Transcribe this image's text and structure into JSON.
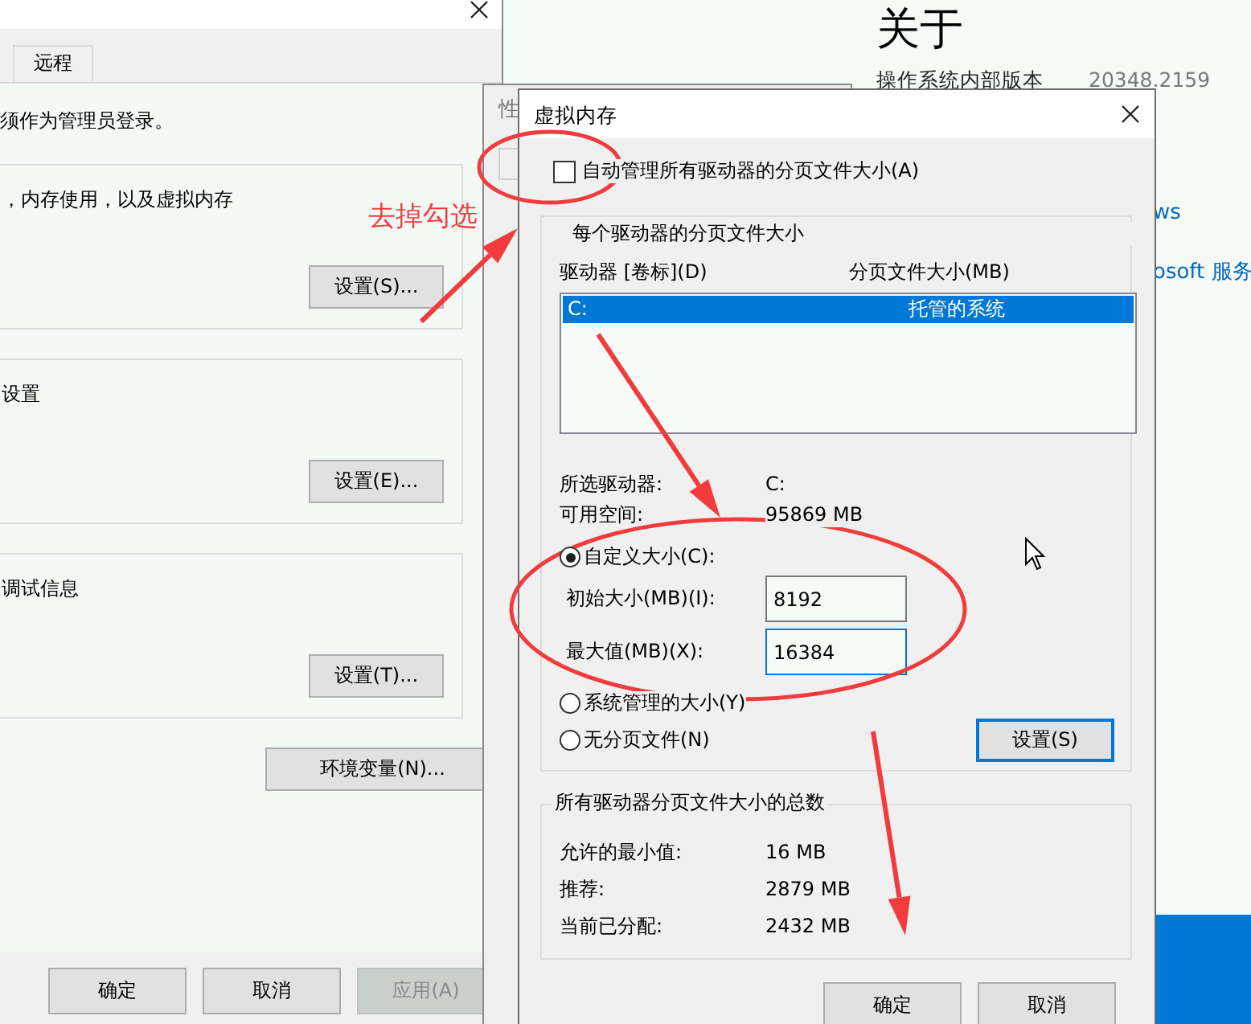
{
  "settings_page": {
    "title": "关于",
    "spec_label": "操作系统内部版本",
    "spec_value": "20348.2159",
    "links": [
      "ws",
      "osoft 服务"
    ]
  },
  "system_properties": {
    "tabs": [
      {
        "label": "远程",
        "selected": false
      }
    ],
    "admin_note": "须作为管理员登录。",
    "groups": [
      {
        "text": "，内存使用，以及虚拟内存",
        "button": "设置(S)..."
      },
      {
        "text": "设置",
        "button": "设置(E)..."
      },
      {
        "text": "调试信息",
        "button": "设置(T)..."
      }
    ],
    "env_button": "环境变量(N)...",
    "buttons": [
      {
        "label": "确定",
        "disabled": false
      },
      {
        "label": "取消",
        "disabled": false
      },
      {
        "label": "应用(A)",
        "disabled": true
      }
    ]
  },
  "performance_options": {
    "title": "性"
  },
  "virtual_memory": {
    "title": "虚拟内存",
    "auto_manage": {
      "label": "自动管理所有驱动器的分页文件大小(A)",
      "checked": false
    },
    "drives_group": {
      "title": "每个驱动器的分页文件大小",
      "columns": [
        "驱动器 [卷标](D)",
        "分页文件大小(MB)"
      ],
      "rows": [
        {
          "drive": "C:",
          "size": "托管的系统",
          "selected": true
        }
      ],
      "info": [
        {
          "label": "所选驱动器:",
          "value": "C:"
        },
        {
          "label": "可用空间:",
          "value": "95869 MB"
        }
      ],
      "options": [
        {
          "label": "自定义大小(C):",
          "selected": true
        },
        {
          "label": "系统管理的大小(Y)",
          "selected": false
        },
        {
          "label": "无分页文件(N)",
          "selected": false
        }
      ],
      "fields": [
        {
          "label": "初始大小(MB)(I):",
          "value": "8192",
          "focused": false
        },
        {
          "label": "最大值(MB)(X):",
          "value": "16384",
          "focused": true
        }
      ],
      "set_button": "设置(S)"
    },
    "totals": {
      "title": "所有驱动器分页文件大小的总数",
      "rows": [
        {
          "label": "允许的最小值:",
          "value": "16 MB"
        },
        {
          "label": "推荐:",
          "value": "2879 MB"
        },
        {
          "label": "当前已分配:",
          "value": "2432 MB"
        }
      ]
    },
    "buttons": [
      "确定",
      "取消"
    ]
  },
  "annotation": {
    "note": "去掉勾选"
  }
}
